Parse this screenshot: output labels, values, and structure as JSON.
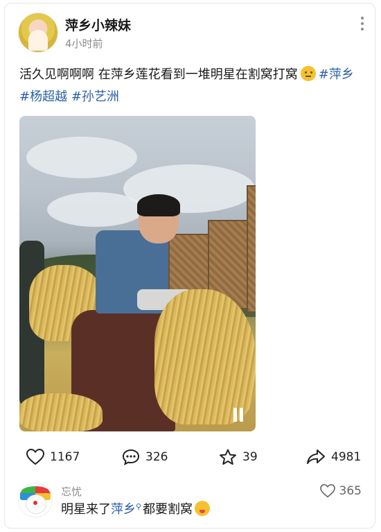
{
  "post": {
    "author": "萍乡小辣妹",
    "time": "4小时前",
    "text_main": "活久见啊啊啊 在萍乡莲花看到一堆明星在割窝打窝",
    "hashtags": [
      "#萍乡",
      "#杨超越",
      "#孙艺洲"
    ]
  },
  "actions": {
    "likes": "1167",
    "comments": "326",
    "favorites": "39",
    "shares": "4981"
  },
  "comment": {
    "user": "忘忧",
    "text_before": "明星来了",
    "link": "萍乡",
    "text_after": "都要割窝",
    "likes": "365"
  },
  "icons": {
    "more": "more-vertical-icon",
    "pause": "pause-icon",
    "like": "heart-icon",
    "comment": "comment-icon",
    "favorite": "star-icon",
    "share": "share-icon",
    "search": "search-icon"
  },
  "colors": {
    "link": "#2a5fa8",
    "secondary_text": "#8a8a8a"
  }
}
